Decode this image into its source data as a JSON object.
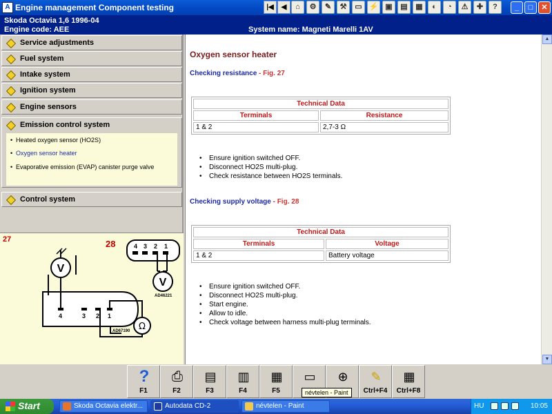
{
  "window": {
    "title": "Engine management Component testing",
    "vehicle": "Skoda   Octavia 1,6  1996-04",
    "engine_code": "Engine code: AEE",
    "system_name": "System name: Magneti Marelli 1AV"
  },
  "toolbar": {
    "nav": [
      "|◀",
      "◀"
    ],
    "icons": [
      "home-icon",
      "engine-icon",
      "tools-icon",
      "spanner-icon",
      "battery-icon",
      "injector-icon",
      "car-icon",
      "printer-icon",
      "notepad-icon",
      "airbag-icon",
      "gauge-icon",
      "warning-icon",
      "service-icon",
      "help-icon"
    ]
  },
  "categories": [
    {
      "label": "Service adjustments"
    },
    {
      "label": "Fuel system"
    },
    {
      "label": "Intake system"
    },
    {
      "label": "Ignition system"
    },
    {
      "label": "Engine sensors"
    },
    {
      "label": "Emission control system"
    },
    {
      "label": "Control system"
    }
  ],
  "emission_items": [
    {
      "label": "Heated oxygen sensor (HO2S)",
      "active": false
    },
    {
      "label": "Oxygen sensor heater",
      "active": true
    },
    {
      "label": "Evaporative emission (EVAP) canister purge valve",
      "active": false
    }
  ],
  "figure": {
    "fig27": "27",
    "fig28": "28",
    "pins_top": [
      "4",
      "3",
      "2",
      "1"
    ],
    "pins_bottom": [
      "4",
      "3",
      "2",
      "1"
    ],
    "voltmeter": "V",
    "ohmmeter": "Ω",
    "code_a": "AD46221",
    "code_b": "AD67190"
  },
  "content": {
    "title": "Oxygen sensor heater",
    "section1": {
      "label": "Checking resistance",
      "fig": "- Fig. 27"
    },
    "table1": {
      "caption": "Technical Data",
      "headers": [
        "Terminals",
        "Resistance"
      ],
      "rows": [
        [
          "1 & 2",
          "2,7-3 Ω"
        ]
      ]
    },
    "steps1": [
      "Ensure ignition switched OFF.",
      "Disconnect HO2S multi-plug.",
      "Check resistance between HO2S terminals."
    ],
    "section2": {
      "label": "Checking supply voltage",
      "fig": "- Fig. 28"
    },
    "table2": {
      "caption": "Technical Data",
      "headers": [
        "Terminals",
        "Voltage"
      ],
      "rows": [
        [
          "1 & 2",
          "Battery voltage"
        ]
      ]
    },
    "steps2": [
      "Ensure ignition switched OFF.",
      "Disconnect HO2S multi-plug.",
      "Start engine.",
      "Allow to idle.",
      "Check voltage between harness multi-plug terminals."
    ]
  },
  "fkeys": [
    "F1",
    "F2",
    "F3",
    "F4",
    "F5",
    "",
    "",
    "Ctrl+F4",
    "Ctrl+F8"
  ],
  "tooltip": "névtelen - Paint",
  "taskbar": {
    "start": "Start",
    "tasks": [
      "Skoda Octavia elektr...",
      "Autodata CD-2",
      "névtelen - Paint"
    ],
    "lang": "HU",
    "clock": "10:05"
  },
  "colors": {
    "title_blue": "#0348c2",
    "info_bar": "#02208a",
    "section_blue": "#1d28a8",
    "header_red": "#c01818",
    "figure_bg": "#fbfbd9"
  }
}
